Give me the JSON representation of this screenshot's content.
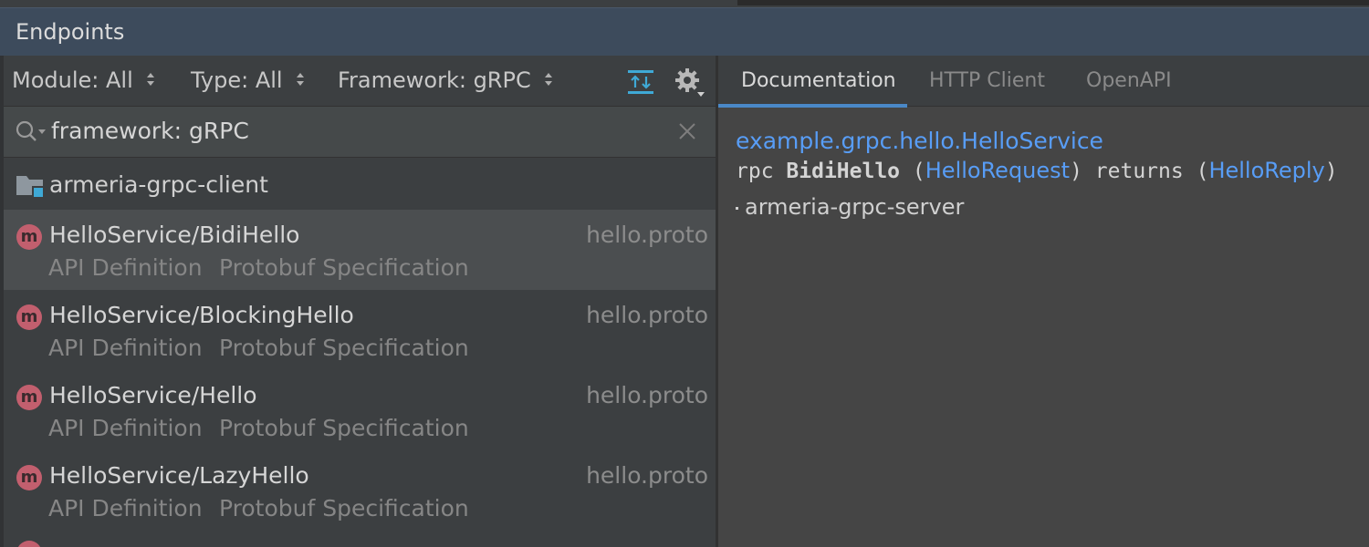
{
  "window": {
    "title": "Endpoints"
  },
  "filters": {
    "module": "Module: All",
    "type": "Type: All",
    "framework": "Framework: gRPC"
  },
  "search": {
    "value": "framework: gRPC"
  },
  "group": {
    "label": "armeria-grpc-client"
  },
  "endpoints": [
    {
      "badge": "m",
      "name": "HelloService/BidiHello",
      "file": "hello.proto",
      "tag1": "API Definition",
      "tag2": "Protobuf Specification",
      "selected": true
    },
    {
      "badge": "m",
      "name": "HelloService/BlockingHello",
      "file": "hello.proto",
      "tag1": "API Definition",
      "tag2": "Protobuf Specification",
      "selected": false
    },
    {
      "badge": "m",
      "name": "HelloService/Hello",
      "file": "hello.proto",
      "tag1": "API Definition",
      "tag2": "Protobuf Specification",
      "selected": false
    },
    {
      "badge": "m",
      "name": "HelloService/LazyHello",
      "file": "hello.proto",
      "tag1": "API Definition",
      "tag2": "Protobuf Specification",
      "selected": false
    }
  ],
  "tabs": [
    "Documentation",
    "HTTP Client",
    "OpenAPI"
  ],
  "doc": {
    "service_link": "example.grpc.hello.HelloService",
    "sig_kw": "rpc",
    "sig_method": "BidiHello",
    "sig_open1": "(",
    "sig_req": "HelloRequest",
    "sig_close1": ")",
    "sig_returns": "returns",
    "sig_open2": "(",
    "sig_resp": "HelloReply",
    "sig_close2": ")",
    "module": "armeria-grpc-server"
  },
  "colors": {
    "accent": "#589df6",
    "method_badge": "#c25f6e",
    "tab_underline": "#4a88c7"
  }
}
